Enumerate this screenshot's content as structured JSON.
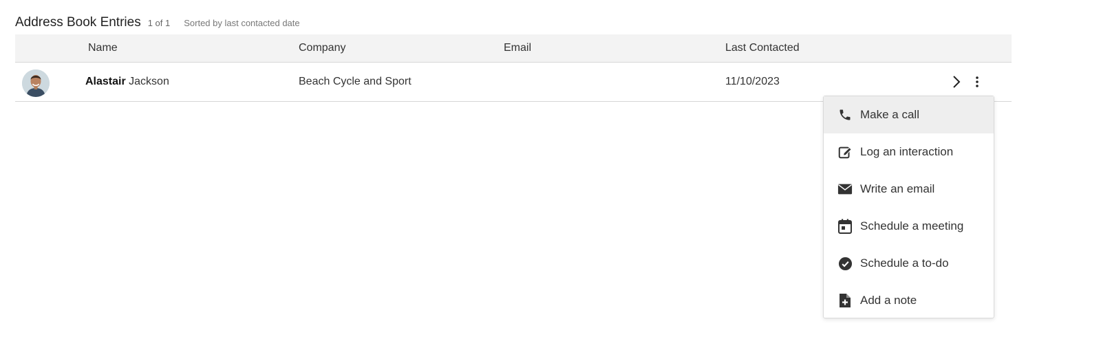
{
  "header": {
    "title": "Address Book Entries",
    "count": "1 of 1",
    "sorted": "Sorted by last contacted date"
  },
  "table": {
    "columns": {
      "name": "Name",
      "company": "Company",
      "email": "Email",
      "last_contacted": "Last Contacted"
    },
    "rows": [
      {
        "first_name": "Alastair",
        "last_name": "Jackson",
        "company": "Beach Cycle and Sport",
        "email": "",
        "last_contacted": "11/10/2023",
        "avatar": "person-photo"
      }
    ]
  },
  "row_actions": {
    "open_icon": "chevron-right-icon",
    "more_icon": "vertical-ellipsis-icon"
  },
  "menu": {
    "items": [
      {
        "label": "Make a call",
        "icon": "phone-icon",
        "highlighted": true
      },
      {
        "label": "Log an interaction",
        "icon": "edit-icon"
      },
      {
        "label": "Write an email",
        "icon": "envelope-icon"
      },
      {
        "label": "Schedule a meeting",
        "icon": "calendar-icon"
      },
      {
        "label": "Schedule a to-do",
        "icon": "check-circle-icon"
      },
      {
        "label": "Add a note",
        "icon": "file-plus-icon"
      }
    ]
  },
  "colors": {
    "header_bg": "#f3f3f3",
    "menu_highlight": "#eeeeee",
    "icon": "#333333"
  }
}
